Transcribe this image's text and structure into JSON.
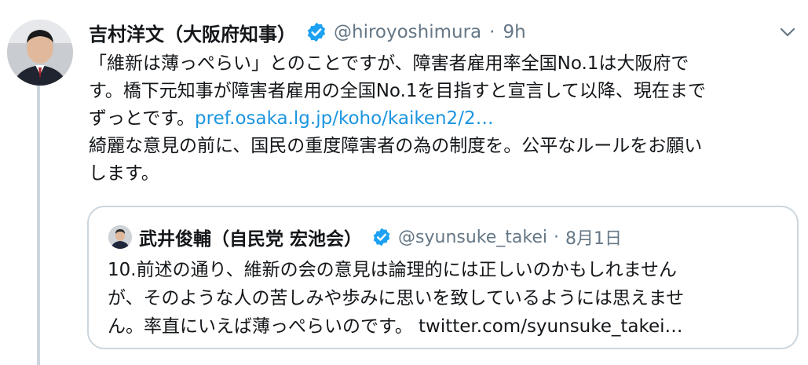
{
  "tweet": {
    "author_name": "吉村洋文（大阪府知事）",
    "handle": "@hiroyoshimura",
    "separator": "·",
    "time": "9h",
    "avatar_icon": "person-photo-avatar",
    "verified_icon": "verified-badge-icon",
    "caret_icon": "chevron-down-icon",
    "body": {
      "line1": "「維新は薄っぺらい」とのことですが、障害者雇用率全国No.1は大阪府で",
      "line2": "す。橋下元知事が障害者雇用の全国No.1を目指すと宣言して以降、現在まで",
      "line3_text": "ずっとです。",
      "line3_link": "pref.osaka.lg.jp/koho/kaiken2/2…",
      "line4": "綺麗な意見の前に、国民の重度障害者の為の制度を。公平なルールをお願い",
      "line5": "します。"
    }
  },
  "quoted_tweet": {
    "author_name": "武井俊輔（自民党 宏池会）",
    "handle": "@syunsuke_takei",
    "separator": "·",
    "time": "8月1日",
    "body": {
      "line1": "10.前述の通り、維新の会の意見は論理的には正しいのかもしれません",
      "line2": "が、そのような人の苦しみや歩みに思いを致しているようには思えませ",
      "line3": "ん。率直にいえば薄っぺらいのです。 twitter.com/syunsuke_takei…"
    }
  },
  "colors": {
    "text": "#14171a",
    "secondary": "#657786",
    "link": "#1b95e0",
    "verified": "#1da1f2",
    "border": "#ccd6dd"
  }
}
